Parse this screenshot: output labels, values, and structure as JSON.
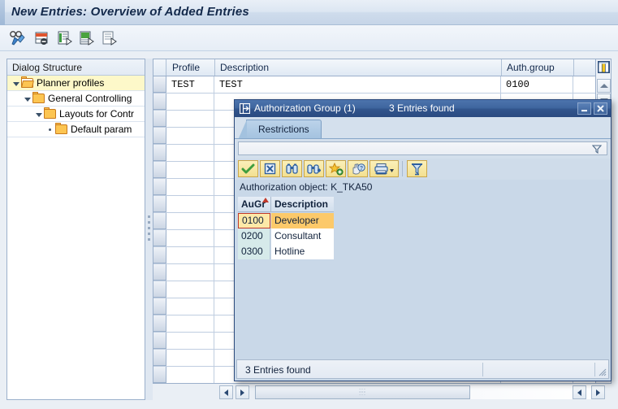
{
  "window": {
    "title": "New Entries: Overview of Added Entries"
  },
  "toolbar": {
    "buttons": [
      {
        "name": "display-change-icon",
        "label": "Display/Change"
      },
      {
        "name": "delete-row-icon",
        "label": "Delete Row"
      },
      {
        "name": "copy-as-icon",
        "label": "Copy As"
      },
      {
        "name": "new-entries-icon",
        "label": "New Entries"
      },
      {
        "name": "select-all-icon",
        "label": "Details"
      }
    ]
  },
  "sidebar": {
    "header": "Dialog Structure",
    "items": [
      {
        "label": "Planner profiles",
        "indent": 0,
        "twisty": "down",
        "folder": "open",
        "selected": true
      },
      {
        "label": "General Controlling",
        "indent": 1,
        "twisty": "down",
        "folder": "closed",
        "selected": false
      },
      {
        "label": "Layouts for Contr",
        "indent": 2,
        "twisty": "down",
        "folder": "closed",
        "selected": false
      },
      {
        "label": "Default param",
        "indent": 3,
        "twisty": "dot",
        "folder": "closed",
        "selected": false
      }
    ]
  },
  "table": {
    "columns": [
      {
        "key": "profile",
        "label": "Profile"
      },
      {
        "key": "description",
        "label": "Description"
      },
      {
        "key": "auth_group",
        "label": "Auth.group"
      }
    ],
    "rows": [
      {
        "profile": "TEST",
        "description": "TEST",
        "auth_group": "0100"
      }
    ],
    "empty_row_count": 17,
    "config_icon": "table-settings-icon",
    "scroll_up_icon": "scroll-up-icon",
    "scroll_down_icon": "scroll-down-icon"
  },
  "hscroll": {
    "left_icon": "arrow-left-icon",
    "right_icon": "arrow-right-icon",
    "end_left_icon": "arrow-left-icon",
    "end_right_icon": "arrow-right-icon"
  },
  "dialog": {
    "icon": "dialog-window-icon",
    "title": "Authorization Group (1)",
    "subtitle": "3 Entries found",
    "minimize_icon": "minimize-icon",
    "close_icon": "close-icon",
    "tab": "Restrictions",
    "filter": {
      "value": "",
      "placeholder": "",
      "icon": "funnel-icon"
    },
    "toolbar_buttons": [
      {
        "name": "confirm-check-icon",
        "label": "Copy"
      },
      {
        "name": "cancel-x-icon",
        "label": "Cancel"
      },
      {
        "name": "find-binoculars-icon",
        "label": "Find"
      },
      {
        "name": "find-next-binoculars-icon",
        "label": "Find Next"
      },
      {
        "name": "add-favorite-star-icon",
        "label": "Insert in Personal Value List"
      },
      {
        "name": "help-hand-icon",
        "label": "Personal Value List"
      },
      {
        "name": "print-icon",
        "label": "Print"
      },
      {
        "name": "filter-funnel-icon",
        "label": "Delete Filter"
      }
    ],
    "auth_object_label": "Authorization object: K_TKA50",
    "result_columns": [
      {
        "key": "augr",
        "label": "AuGr",
        "sorted": true
      },
      {
        "key": "description",
        "label": "Description",
        "sorted": false
      }
    ],
    "result_rows": [
      {
        "augr": "0100",
        "description": "Developer",
        "selected": true
      },
      {
        "augr": "0200",
        "description": "Consultant",
        "selected": false
      },
      {
        "augr": "0300",
        "description": "Hotline",
        "selected": false
      }
    ],
    "status": "3 Entries found",
    "resize_grip_icon": "resize-grip-icon"
  }
}
